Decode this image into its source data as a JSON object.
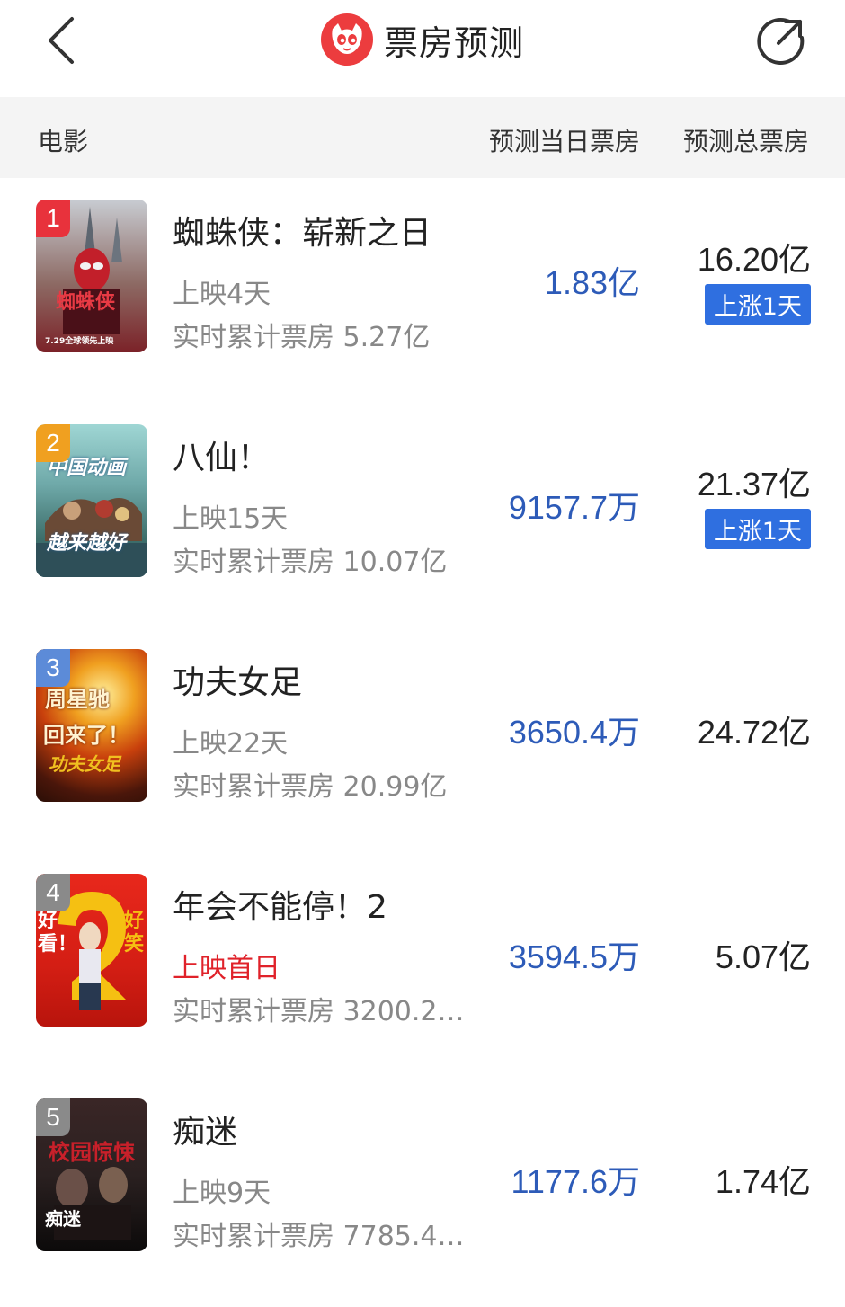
{
  "header": {
    "title": "票房预测"
  },
  "columns": {
    "movie": "电影",
    "day_forecast": "预测当日票房",
    "total_forecast": "预测总票房"
  },
  "movies": [
    {
      "rank": "1",
      "name": "蜘蛛侠：崭新之日",
      "days": "上映4天",
      "cumulative": "实时累计票房 5.27亿",
      "daily": "1.83亿",
      "total": "16.20亿",
      "badge": "上涨1天",
      "poster_text": [
        "蜘蛛侠",
        "7.29全球领先上映"
      ],
      "rank_color": "#e8323c",
      "poster_colors": [
        "#c8ccd2",
        "#7b2228"
      ]
    },
    {
      "rank": "2",
      "name": "八仙！",
      "days": "上映15天",
      "cumulative": "实时累计票房 10.07亿",
      "daily": "9157.7万",
      "total": "21.37亿",
      "badge": "上涨1天",
      "poster_text": [
        "中国动画",
        "越来越好"
      ],
      "rank_color": "#f0a020",
      "poster_colors": [
        "#7fbfc0",
        "#2e5f68"
      ]
    },
    {
      "rank": "3",
      "name": "功夫女足",
      "days": "上映22天",
      "cumulative": "实时累计票房 20.99亿",
      "daily": "3650.4万",
      "total": "24.72亿",
      "badge": "",
      "poster_text": [
        "周星驰",
        "回来了！",
        "功夫女足"
      ],
      "rank_color": "#5c8bd8",
      "poster_colors": [
        "#f0a020",
        "#2a0e06"
      ]
    },
    {
      "rank": "4",
      "name": "年会不能停！2",
      "days": "上映首日",
      "days_highlight": true,
      "cumulative": "实时累计票房 3200.2…",
      "daily": "3594.5万",
      "total": "5.07亿",
      "badge": "",
      "poster_text": [
        "好看！",
        "好笑！"
      ],
      "rank_color": "#8a8a8a",
      "poster_colors": [
        "#e02418",
        "#b8140c"
      ]
    },
    {
      "rank": "5",
      "name": "痴迷",
      "days": "上映9天",
      "cumulative": "实时累计票房 7785.4…",
      "daily": "1177.6万",
      "total": "1.74亿",
      "badge": "",
      "poster_text": [
        "校园惊悚",
        "痴迷"
      ],
      "rank_color": "#8a8a8a",
      "poster_colors": [
        "#2a2020",
        "#0c0a0a"
      ]
    }
  ],
  "colors": {
    "daily_value": "#2d5bb8",
    "badge_bg": "#2f6fe0",
    "brand_red": "#ec3c3e"
  }
}
